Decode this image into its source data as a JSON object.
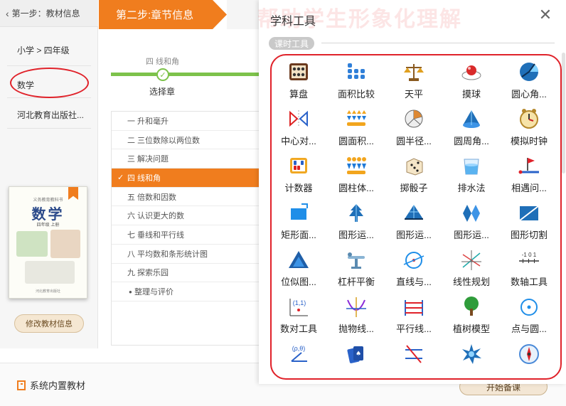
{
  "step1": {
    "label": "第一步：教材信息"
  },
  "step2": {
    "label": "第二步:章节信息"
  },
  "left": {
    "grade": "小学 > 四年级",
    "subject": "数学",
    "publisher": "河北教育出版社...",
    "modify_button": "修改教材信息",
    "book": {
      "series": "义务教育教科书",
      "title": "数学",
      "subtitle": "四年级 上册",
      "publisher": "河北教育出版社"
    }
  },
  "chapter_head": "四  线和角",
  "select_label": "选择章",
  "chapters": [
    "一  升和毫升",
    "二  三位数除以两位数",
    "三  解决问题",
    "四  线和角",
    "五  倍数和因数",
    "六  认识更大的数",
    "七  垂线和平行线",
    "八  平均数和条形统计图",
    "九  探索乐园",
    "整理与评价"
  ],
  "active_chapter_index": 3,
  "bottom": {
    "builtin_label": "系统内置教材",
    "start_button": "开始备课"
  },
  "panel": {
    "watermark": "帮助学生形象化理解",
    "title": "学科工具",
    "section": "课时工具",
    "tools": [
      {
        "label": "算盘",
        "icon": "abacus-icon"
      },
      {
        "label": "面积比较",
        "icon": "dots-grid-icon"
      },
      {
        "label": "天平",
        "icon": "balance-icon"
      },
      {
        "label": "摸球",
        "icon": "ball-icon"
      },
      {
        "label": "圆心角...",
        "icon": "circle-sector-icon"
      },
      {
        "label": "中心对...",
        "icon": "symmetry-icon"
      },
      {
        "label": "圆面积...",
        "icon": "circle-area-icon"
      },
      {
        "label": "圆半径...",
        "icon": "circle-radius-icon"
      },
      {
        "label": "圆周角...",
        "icon": "cone-icon"
      },
      {
        "label": "模拟时钟",
        "icon": "clock-icon"
      },
      {
        "label": "计数器",
        "icon": "counter-icon"
      },
      {
        "label": "圆柱体...",
        "icon": "cylinder-icon"
      },
      {
        "label": "掷骰子",
        "icon": "dice-icon"
      },
      {
        "label": "排水法",
        "icon": "water-cup-icon"
      },
      {
        "label": "相遇问...",
        "icon": "flag-track-icon"
      },
      {
        "label": "矩形面...",
        "icon": "rectangle-area-icon"
      },
      {
        "label": "图形运...",
        "icon": "tree-shape-icon"
      },
      {
        "label": "图形运...",
        "icon": "triangle-move-icon"
      },
      {
        "label": "图形运...",
        "icon": "diamond-move-icon"
      },
      {
        "label": "图形切割",
        "icon": "shape-cut-icon"
      },
      {
        "label": "位似图...",
        "icon": "similar-triangle-icon"
      },
      {
        "label": "杠杆平衡",
        "icon": "lever-icon"
      },
      {
        "label": "直线与...",
        "icon": "line-circle-icon"
      },
      {
        "label": "线性规划",
        "icon": "linear-plan-icon"
      },
      {
        "label": "数轴工具",
        "icon": "number-line-icon"
      },
      {
        "label": "数对工具",
        "icon": "coordinate-pair-icon"
      },
      {
        "label": "抛物线...",
        "icon": "parabola-icon"
      },
      {
        "label": "平行线...",
        "icon": "parallel-lines-icon"
      },
      {
        "label": "植树模型",
        "icon": "tree-icon"
      },
      {
        "label": "点与圆...",
        "icon": "point-circle-icon"
      },
      {
        "label": "",
        "icon": "polar-icon"
      },
      {
        "label": "",
        "icon": "cards-icon"
      },
      {
        "label": "",
        "icon": "crossing-lines-icon"
      },
      {
        "label": "",
        "icon": "star-burst-icon"
      },
      {
        "label": "",
        "icon": "compass-icon"
      }
    ],
    "polar_text": "(ρ,θ)",
    "pair_text": "(1,1)",
    "numline_text": "-1 0 1",
    "pair_grid": "xy"
  },
  "colors": {
    "accent": "#f07d1e",
    "annotation_red": "#e0222a",
    "progress_green": "#7dc24b"
  }
}
